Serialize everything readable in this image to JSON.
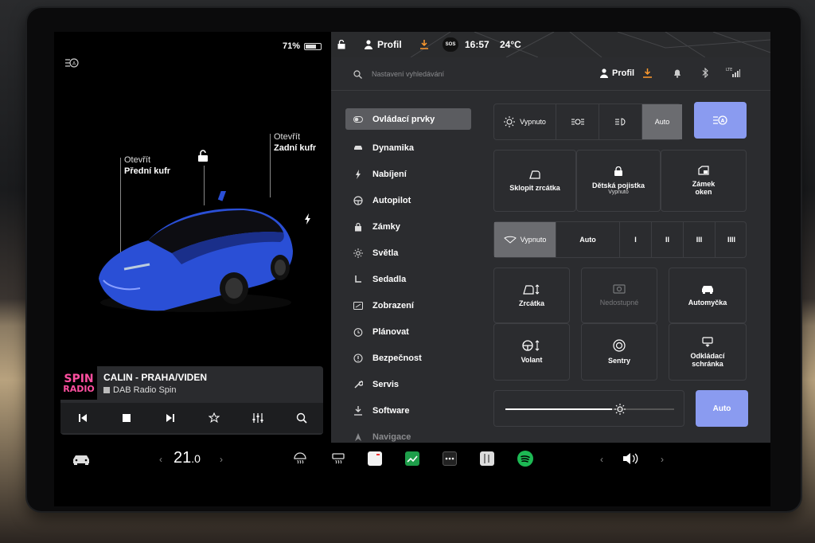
{
  "status": {
    "battery_percent": "71%",
    "battery_level": 0.71,
    "profile": "Profil",
    "time": "16:57",
    "temperature": "24°C",
    "sos": "SOS"
  },
  "car_view": {
    "frunk_line1": "Otevřít",
    "frunk_line2": "Přední kufr",
    "trunk_line1": "Otevřít",
    "trunk_line2": "Zadní kufr",
    "car_color": "#2a4fd6"
  },
  "media": {
    "logo_line1": "SPIN",
    "logo_line2": "RADIO",
    "title": "CALIN - PRAHA/VIDEN",
    "source": "DAB Radio Spin"
  },
  "search": {
    "placeholder": "Nastavení vyhledávání",
    "profile": "Profil"
  },
  "menu": [
    {
      "label": "Ovládací prvky",
      "icon": "toggle-icon",
      "active": true
    },
    {
      "label": "Dynamika",
      "icon": "car-icon"
    },
    {
      "label": "Nabíjení",
      "icon": "bolt-icon"
    },
    {
      "label": "Autopilot",
      "icon": "steering-icon"
    },
    {
      "label": "Zámky",
      "icon": "lock-icon"
    },
    {
      "label": "Světla",
      "icon": "light-icon"
    },
    {
      "label": "Sedadla",
      "icon": "seat-icon"
    },
    {
      "label": "Zobrazení",
      "icon": "display-icon"
    },
    {
      "label": "Plánovat",
      "icon": "clock-icon"
    },
    {
      "label": "Bezpečnost",
      "icon": "info-icon"
    },
    {
      "label": "Servis",
      "icon": "wrench-icon"
    },
    {
      "label": "Software",
      "icon": "download-icon"
    },
    {
      "label": "Navigace",
      "icon": "nav-icon"
    }
  ],
  "lights": {
    "off": "Vypnuto",
    "auto": "Auto"
  },
  "controls": {
    "fold_mirrors": "Sklopit zrcátka",
    "child_lock": "Dětská pojistka",
    "child_lock_state": "Vypnuto",
    "window_lock_1": "Zámek",
    "window_lock_2": "oken"
  },
  "wipers": {
    "off": "Vypnuto",
    "auto": "Auto",
    "speeds": [
      "I",
      "II",
      "III",
      "IIII"
    ]
  },
  "adjust": {
    "mirrors": "Zrcátka",
    "unavailable": "Nedostupné",
    "carwash": "Automyčka",
    "wheel": "Volant",
    "sentry": "Sentry",
    "glovebox_1": "Odkládací",
    "glovebox_2": "schránka"
  },
  "brightness": {
    "level": 0.68,
    "auto": "Auto"
  },
  "dock": {
    "temp_int": "21",
    "temp_dec": ".0",
    "accent_green": "#1db954"
  }
}
